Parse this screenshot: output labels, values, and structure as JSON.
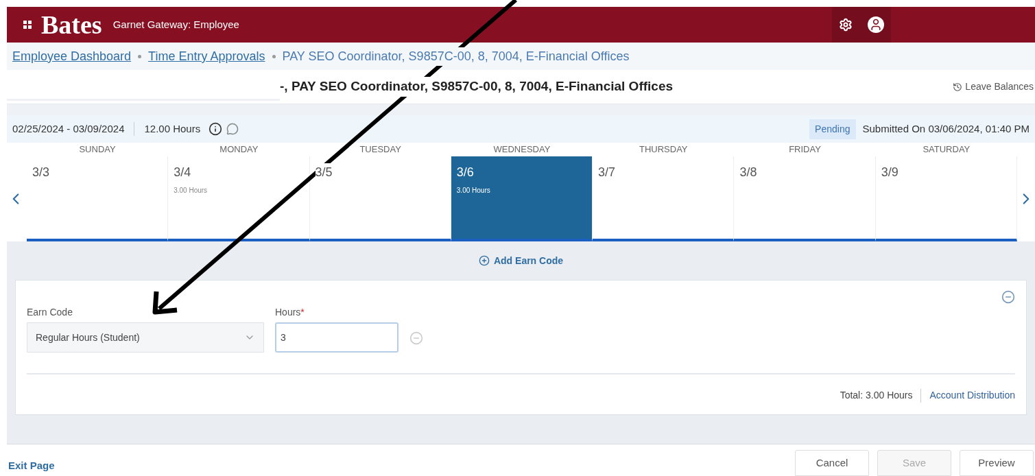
{
  "app_bar": {
    "logo": "Bates",
    "subtitle": "Garnet Gateway: Employee"
  },
  "breadcrumbs": [
    {
      "label": "Employee Dashboard",
      "kind": "link"
    },
    {
      "label": "Time Entry Approvals",
      "kind": "link"
    },
    {
      "label": "PAY SEO Coordinator, S9857C-00, 8, 7004, E-Financial Offices",
      "kind": "current"
    }
  ],
  "header": {
    "title": "-, PAY SEO Coordinator, S9857C-00, 8, 7004, E-Financial Offices",
    "leave_balances": "Leave Balances"
  },
  "period": {
    "range": "02/25/2024 - 03/09/2024",
    "hours": "12.00 Hours",
    "status": "Pending",
    "submitted": "Submitted On 03/06/2024, 01:40 PM"
  },
  "days": [
    {
      "weekday": "SUNDAY",
      "date": "3/3",
      "selected": false
    },
    {
      "weekday": "MONDAY",
      "date": "3/4",
      "hours": "3.00 Hours",
      "selected": false
    },
    {
      "weekday": "TUESDAY",
      "date": "3/5",
      "selected": false
    },
    {
      "weekday": "WEDNESDAY",
      "date": "3/6",
      "hours": "3.00 Hours",
      "selected": true
    },
    {
      "weekday": "THURSDAY",
      "date": "3/7",
      "selected": false
    },
    {
      "weekday": "FRIDAY",
      "date": "3/8",
      "selected": false
    },
    {
      "weekday": "SATURDAY",
      "date": "3/9",
      "selected": false
    }
  ],
  "add_earn_code": "Add Earn Code",
  "entry": {
    "earn_code_label": "Earn Code",
    "earn_code": "Regular Hours (Student)",
    "hours_label": "Hours",
    "required_mark": "*",
    "hours": "3",
    "total": "Total: 3.00 Hours",
    "account_distribution": "Account Distribution"
  },
  "footer": {
    "exit": "Exit Page",
    "buttons": [
      {
        "label": "Cancel",
        "disabled": false
      },
      {
        "label": "Save",
        "disabled": true
      },
      {
        "label": "Preview",
        "disabled": false
      }
    ]
  }
}
